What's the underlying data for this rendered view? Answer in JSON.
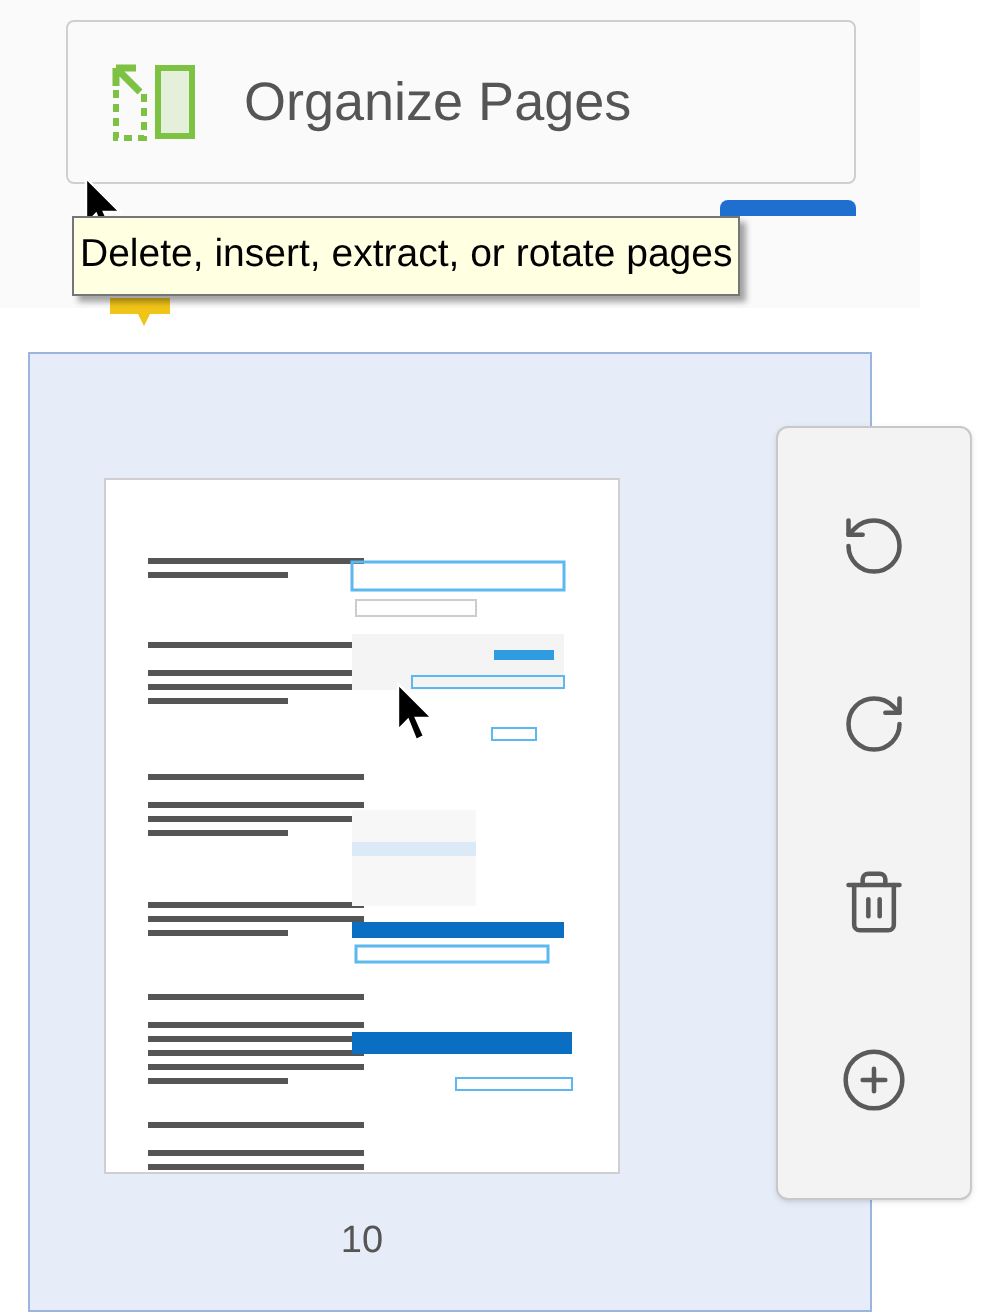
{
  "organize_button": {
    "label": "Organize Pages"
  },
  "tooltip": {
    "text": "Delete, insert, extract, or rotate pages"
  },
  "page_thumbnail": {
    "selected": true,
    "page_number": "10"
  },
  "page_tools": [
    {
      "kind": "rotate_left"
    },
    {
      "kind": "rotate_right"
    },
    {
      "kind": "delete"
    },
    {
      "kind": "insert"
    }
  ]
}
